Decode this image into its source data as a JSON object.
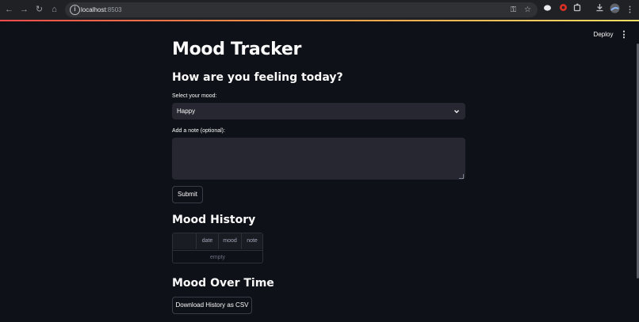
{
  "browser": {
    "url_host": "localhost",
    "url_port": ":8503",
    "icons": [
      "back-icon",
      "forward-icon",
      "reload-icon",
      "home-icon",
      "info-icon",
      "password-key-icon",
      "star-icon",
      "extension-icon",
      "extension-red-icon",
      "puzzle-icon",
      "download-icon",
      "profile-icon",
      "menu-icon"
    ]
  },
  "app_header": {
    "deploy_label": "Deploy",
    "menu_label": "⋮"
  },
  "page": {
    "title": "Mood Tracker",
    "section_feeling": "How are you feeling today?",
    "mood_select": {
      "label": "Select your mood:",
      "value": "Happy"
    },
    "note_field": {
      "label": "Add a note (optional):",
      "value": ""
    },
    "submit_label": "Submit",
    "section_history": "Mood History",
    "history_table": {
      "columns": [
        "date",
        "mood",
        "note"
      ],
      "empty_text": "empty"
    },
    "section_over_time": "Mood Over Time",
    "download_label": "Download History as CSV"
  },
  "colors": {
    "background": "#0e1117",
    "input_bg": "#262730",
    "text": "#fafafa",
    "accent_gradient": [
      "#ff4b4b",
      "#ffe066"
    ]
  }
}
